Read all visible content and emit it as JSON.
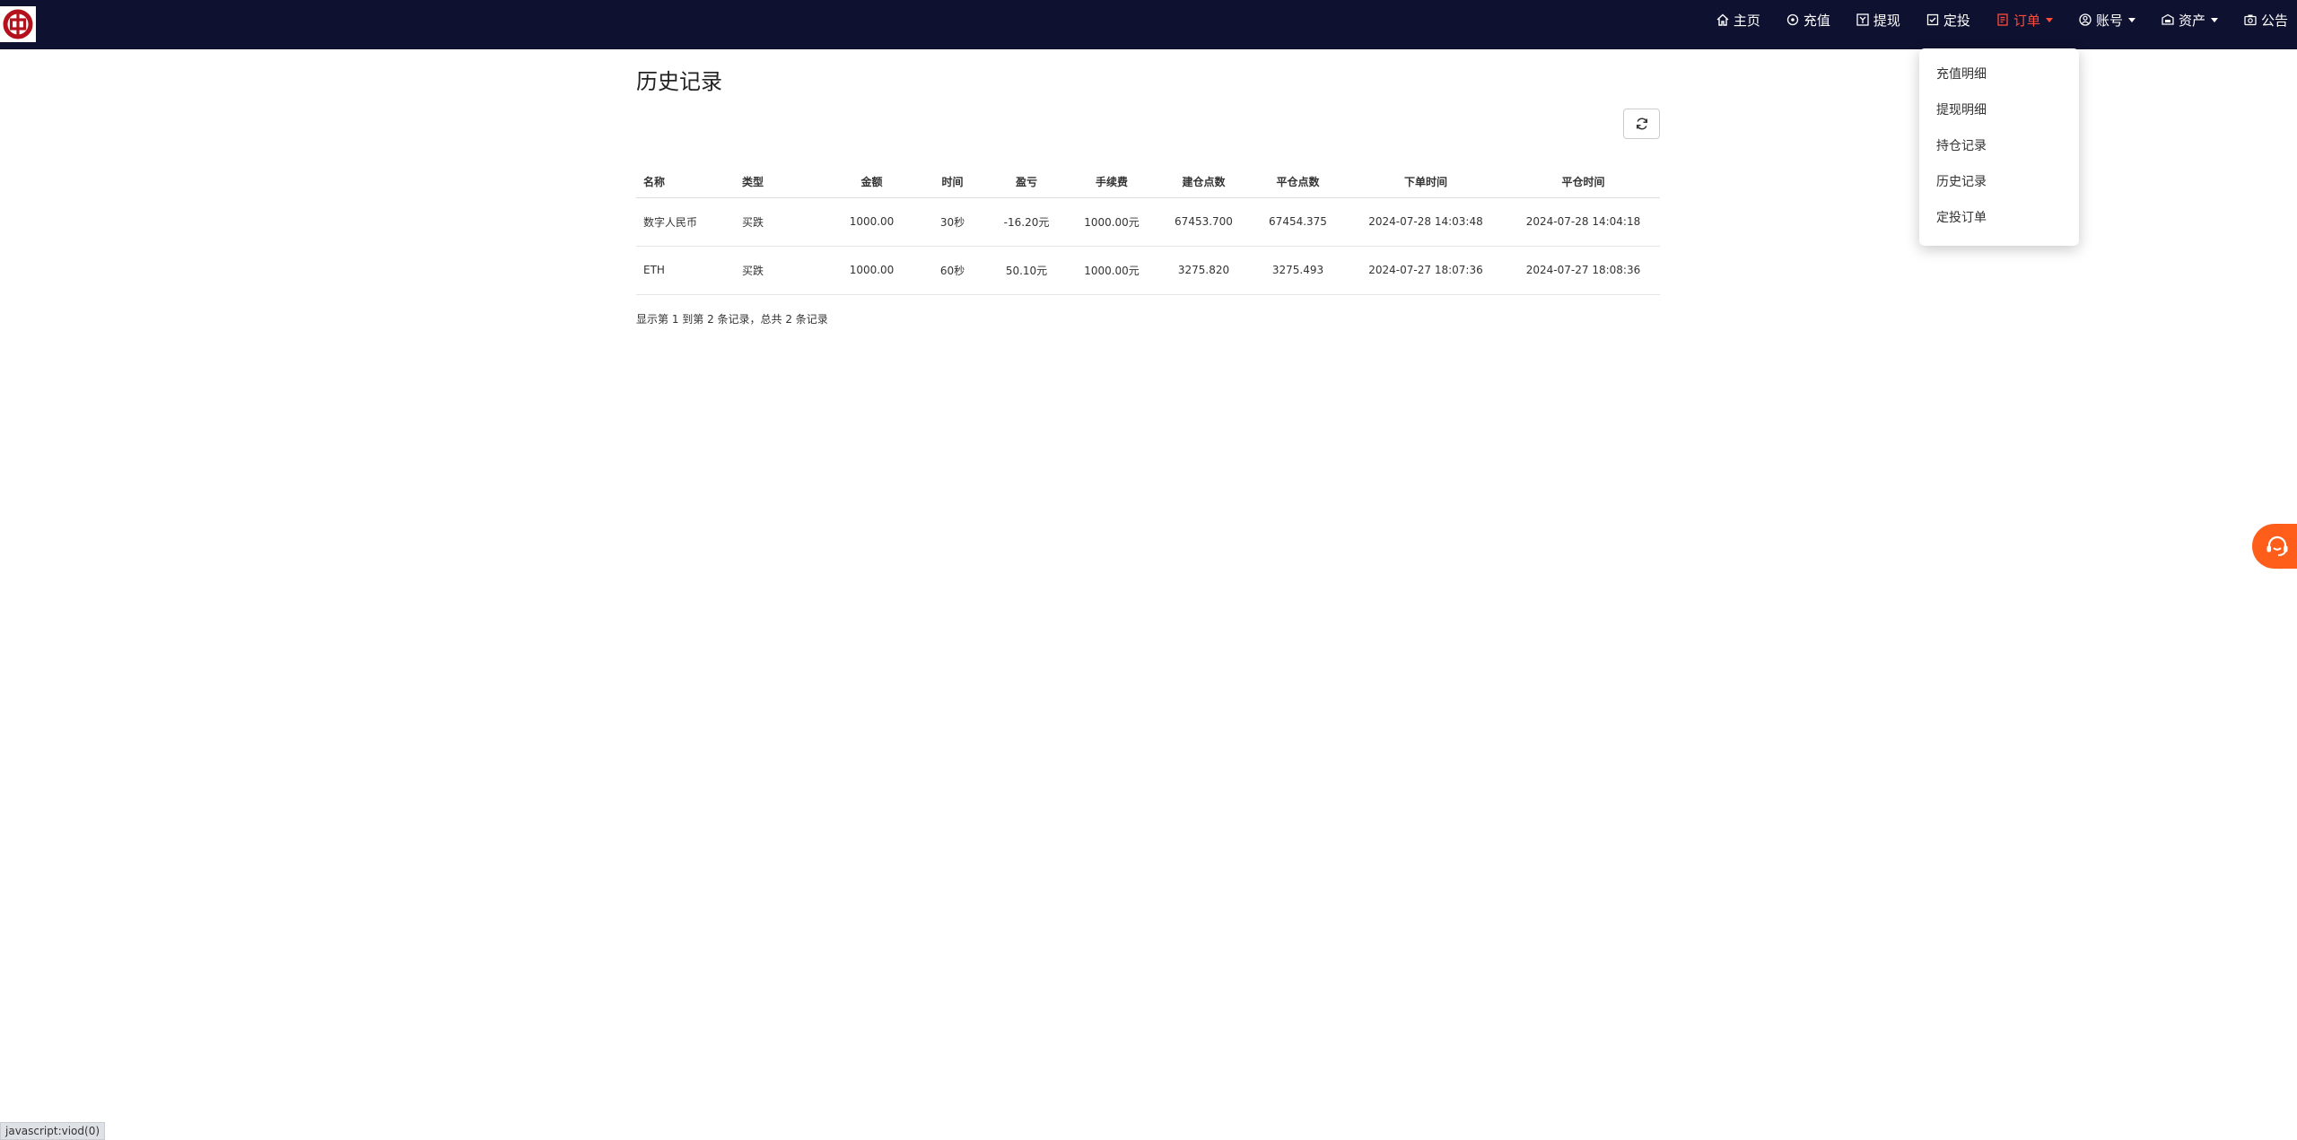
{
  "nav": {
    "items": [
      {
        "label": "主页",
        "icon": "home-icon"
      },
      {
        "label": "充值",
        "icon": "recharge-icon"
      },
      {
        "label": "提现",
        "icon": "withdraw-icon"
      },
      {
        "label": "定投",
        "icon": "check-square-icon"
      },
      {
        "label": "订单",
        "icon": "order-icon",
        "active": true,
        "has_caret": true
      },
      {
        "label": "账号",
        "icon": "account-icon",
        "has_caret": true
      },
      {
        "label": "资产",
        "icon": "wallet-icon",
        "has_caret": true
      },
      {
        "label": "公告",
        "icon": "camera-icon"
      }
    ],
    "active_color": "#ff4b3a",
    "bg_color": "#0f1130"
  },
  "dropdown": {
    "items": [
      "充值明细",
      "提现明细",
      "持仓记录",
      "历史记录",
      "定投订单"
    ]
  },
  "page": {
    "title": "历史记录"
  },
  "table": {
    "headers": [
      "名称",
      "类型",
      "金额",
      "时间",
      "盈亏",
      "手续费",
      "建仓点数",
      "平仓点数",
      "下单时间",
      "平仓时间"
    ],
    "rows": [
      [
        "数字人民币",
        "买跌",
        "1000.00",
        "30秒",
        "-16.20元",
        "1000.00元",
        "67453.700",
        "67454.375",
        "2024-07-28 14:03:48",
        "2024-07-28 14:04:18"
      ],
      [
        "ETH",
        "买跌",
        "1000.00",
        "60秒",
        "50.10元",
        "1000.00元",
        "3275.820",
        "3275.493",
        "2024-07-27 18:07:36",
        "2024-07-27 18:08:36"
      ]
    ]
  },
  "pagination": {
    "info": "显示第 1 到第 2 条记录，总共 2 条记录"
  },
  "statusbar": {
    "text": "javascript:viod(0)"
  },
  "colors": {
    "service_button": "#ff5e1a",
    "logo_red": "#b3121d"
  }
}
